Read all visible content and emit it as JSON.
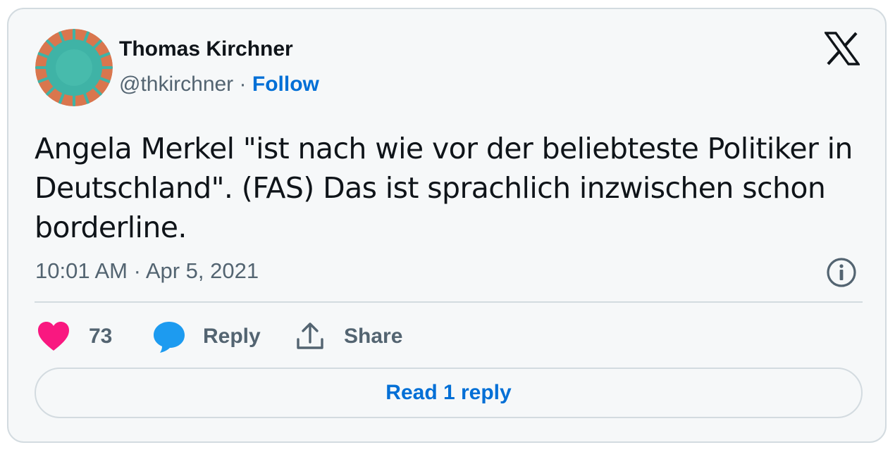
{
  "author": {
    "name": "Thomas Kirchner",
    "handle": "@thkirchner",
    "separator": "·",
    "follow_label": "Follow"
  },
  "icons": {
    "brand": "x-logo-icon",
    "info": "info-icon",
    "like": "heart-icon",
    "reply": "speech-bubble-icon",
    "share": "share-upload-icon"
  },
  "tweet": {
    "text": "Angela Merkel \"ist nach wie vor der beliebteste Politiker in Deutschland\". (FAS) Das ist sprachlich inzwischen schon borderline.",
    "timestamp": "10:01 AM · Apr 5, 2021"
  },
  "actions": {
    "like_count": "73",
    "reply_label": "Reply",
    "share_label": "Share"
  },
  "read_replies_label": "Read 1 reply",
  "colors": {
    "link": "#006fd6",
    "like": "#f91880",
    "reply": "#1d9bf0",
    "secondary_text": "#536471",
    "border": "#d3dbe0"
  }
}
